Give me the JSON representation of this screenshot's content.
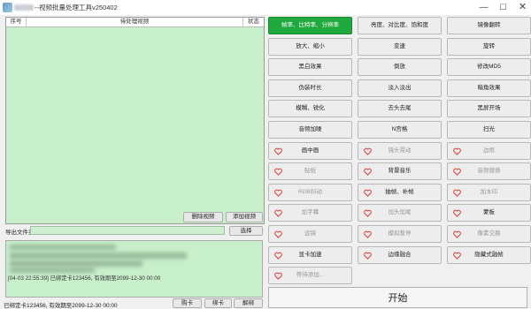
{
  "window": {
    "title": "--视频批量处理工具v250402",
    "minimize": "—",
    "maximize": "☐",
    "close": "✕"
  },
  "table": {
    "col_seq": "序号",
    "col_file": "待处理视频",
    "col_state": "状态"
  },
  "buttons": {
    "delete": "删除视频",
    "add": "添加视频",
    "browse": "选择",
    "bind": "购卡",
    "unbind": "绑卡",
    "untie": "解绑",
    "start": "开始"
  },
  "export": {
    "label": "导出文件夹",
    "value": ""
  },
  "log": {
    "line1": "[04-03 22:55:39] 已绑定卡123456, 有效期至2099-12-30 00:00"
  },
  "status": {
    "text": "已绑定卡123456, 有效期至2099-12-30 00:00"
  },
  "features": [
    {
      "label": "帧率、比特率、分辨率",
      "state": "active"
    },
    {
      "label": "亮度、对比度、饱和度",
      "state": "normal"
    },
    {
      "label": "镜像翻转",
      "state": "normal"
    },
    {
      "label": "放大、缩小",
      "state": "normal"
    },
    {
      "label": "变速",
      "state": "normal"
    },
    {
      "label": "旋转",
      "state": "normal"
    },
    {
      "label": "黑白效果",
      "state": "normal"
    },
    {
      "label": "倒放",
      "state": "normal"
    },
    {
      "label": "修改MD5",
      "state": "normal"
    },
    {
      "label": "伪装时长",
      "state": "normal"
    },
    {
      "label": "淡入淡出",
      "state": "normal"
    },
    {
      "label": "暗角效果",
      "state": "normal"
    },
    {
      "label": "模糊、锐化",
      "state": "normal"
    },
    {
      "label": "去头去尾",
      "state": "normal"
    },
    {
      "label": "黑屏开场",
      "state": "normal"
    },
    {
      "label": "音频加噪",
      "state": "normal"
    },
    {
      "label": "N宫格",
      "state": "normal"
    },
    {
      "label": "扫光",
      "state": "normal"
    },
    {
      "label": "画中画",
      "state": "vip"
    },
    {
      "label": "镜头晃动",
      "state": "locked"
    },
    {
      "label": "边框",
      "state": "locked"
    },
    {
      "label": "贴纸",
      "state": "locked"
    },
    {
      "label": "背景音乐",
      "state": "vip"
    },
    {
      "label": "音频替换",
      "state": "locked"
    },
    {
      "label": "RGB抖动",
      "state": "locked"
    },
    {
      "label": "抽帧、补帧",
      "state": "vip"
    },
    {
      "label": "加水印",
      "state": "locked"
    },
    {
      "label": "加字幕",
      "state": "locked"
    },
    {
      "label": "加头加尾",
      "state": "locked"
    },
    {
      "label": "蒙板",
      "state": "vip"
    },
    {
      "label": "运镜",
      "state": "locked"
    },
    {
      "label": "模拟暂停",
      "state": "locked"
    },
    {
      "label": "像素交换",
      "state": "locked"
    },
    {
      "label": "显卡加速",
      "state": "vip"
    },
    {
      "label": "边缘融合",
      "state": "vip"
    },
    {
      "label": "隐藏式融帧",
      "state": "vip"
    },
    {
      "label": "等待添加...",
      "state": "locked"
    }
  ],
  "colors": {
    "accent": "#1fa83c",
    "list_bg": "#c7efca",
    "heart": "#e0514f"
  }
}
